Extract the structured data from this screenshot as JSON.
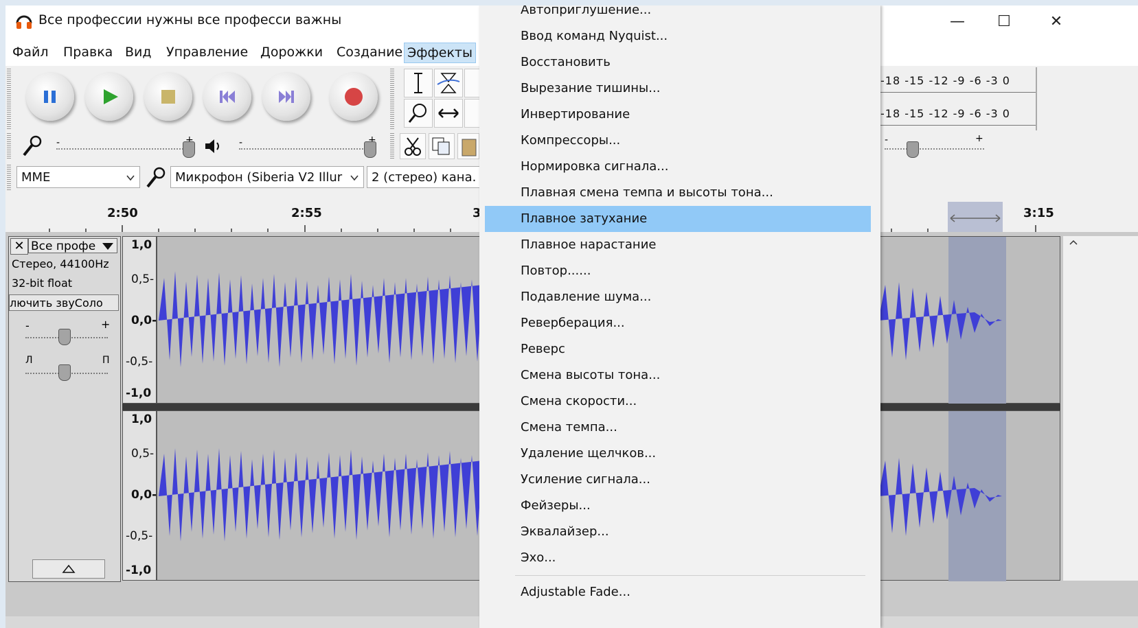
{
  "window": {
    "title": "Все профессии нужны все професси важны",
    "minimize": "—",
    "maximize": "☐",
    "close": "✕"
  },
  "menubar": {
    "items": [
      "Файл",
      "Правка",
      "Вид",
      "Управление",
      "Дорожки",
      "Создание",
      "Эффекты"
    ],
    "active": "Эффекты"
  },
  "meters": {
    "record_scale": "-18 -15 -12  -9  -6  -3  0",
    "play_scale": "-18 -15 -12  -9  -6  -3  0"
  },
  "mixer": {
    "minus": "-",
    "plus": "+"
  },
  "device": {
    "host": "MME",
    "input": "Микрофон (Siberia V2 Illur",
    "channels": "2 (стерео) кана."
  },
  "ruler": {
    "labels": [
      "2:50",
      "2:55",
      "3",
      "3:15"
    ]
  },
  "track": {
    "name": "Все профе",
    "info_rate": "Стерео, 44100Hz",
    "info_format": "32-bit float",
    "mute_solo": "лючить звуСоло",
    "gain_minus": "-",
    "gain_plus": "+",
    "pan_left": "Л",
    "pan_right": "П",
    "scale_top": [
      "1,0",
      "0,5-",
      "0,0-",
      "-0,5-",
      "-1,0"
    ],
    "scale_bottom": [
      "1,0",
      "0,5-",
      "0,0-",
      "-0,5-",
      "-1,0"
    ]
  },
  "effects_menu": {
    "items": [
      "Автоприглушение...",
      "Ввод команд Nyquist...",
      "Восстановить",
      "Вырезание тишины...",
      "Инвертирование",
      "Компрессоры...",
      "Нормировка сигнала...",
      "Плавная смена темпа и высоты тона...",
      "Плавное затухание",
      "Плавное нарастание",
      "Повтор......",
      "Подавление шума...",
      "Реверберация...",
      "Реверс",
      "Смена высоты тона...",
      "Смена скорости...",
      "Смена темпа...",
      "Удаление щелчков...",
      "Усиление сигнала...",
      "Фейзеры...",
      "Эквалайзер...",
      "Эхо...",
      "Adjustable Fade..."
    ],
    "highlighted": "Плавное затухание"
  },
  "colors": {
    "waveform": "#3f3fd6",
    "highlight": "#91c9f7",
    "selection": "#9aa1b8"
  }
}
